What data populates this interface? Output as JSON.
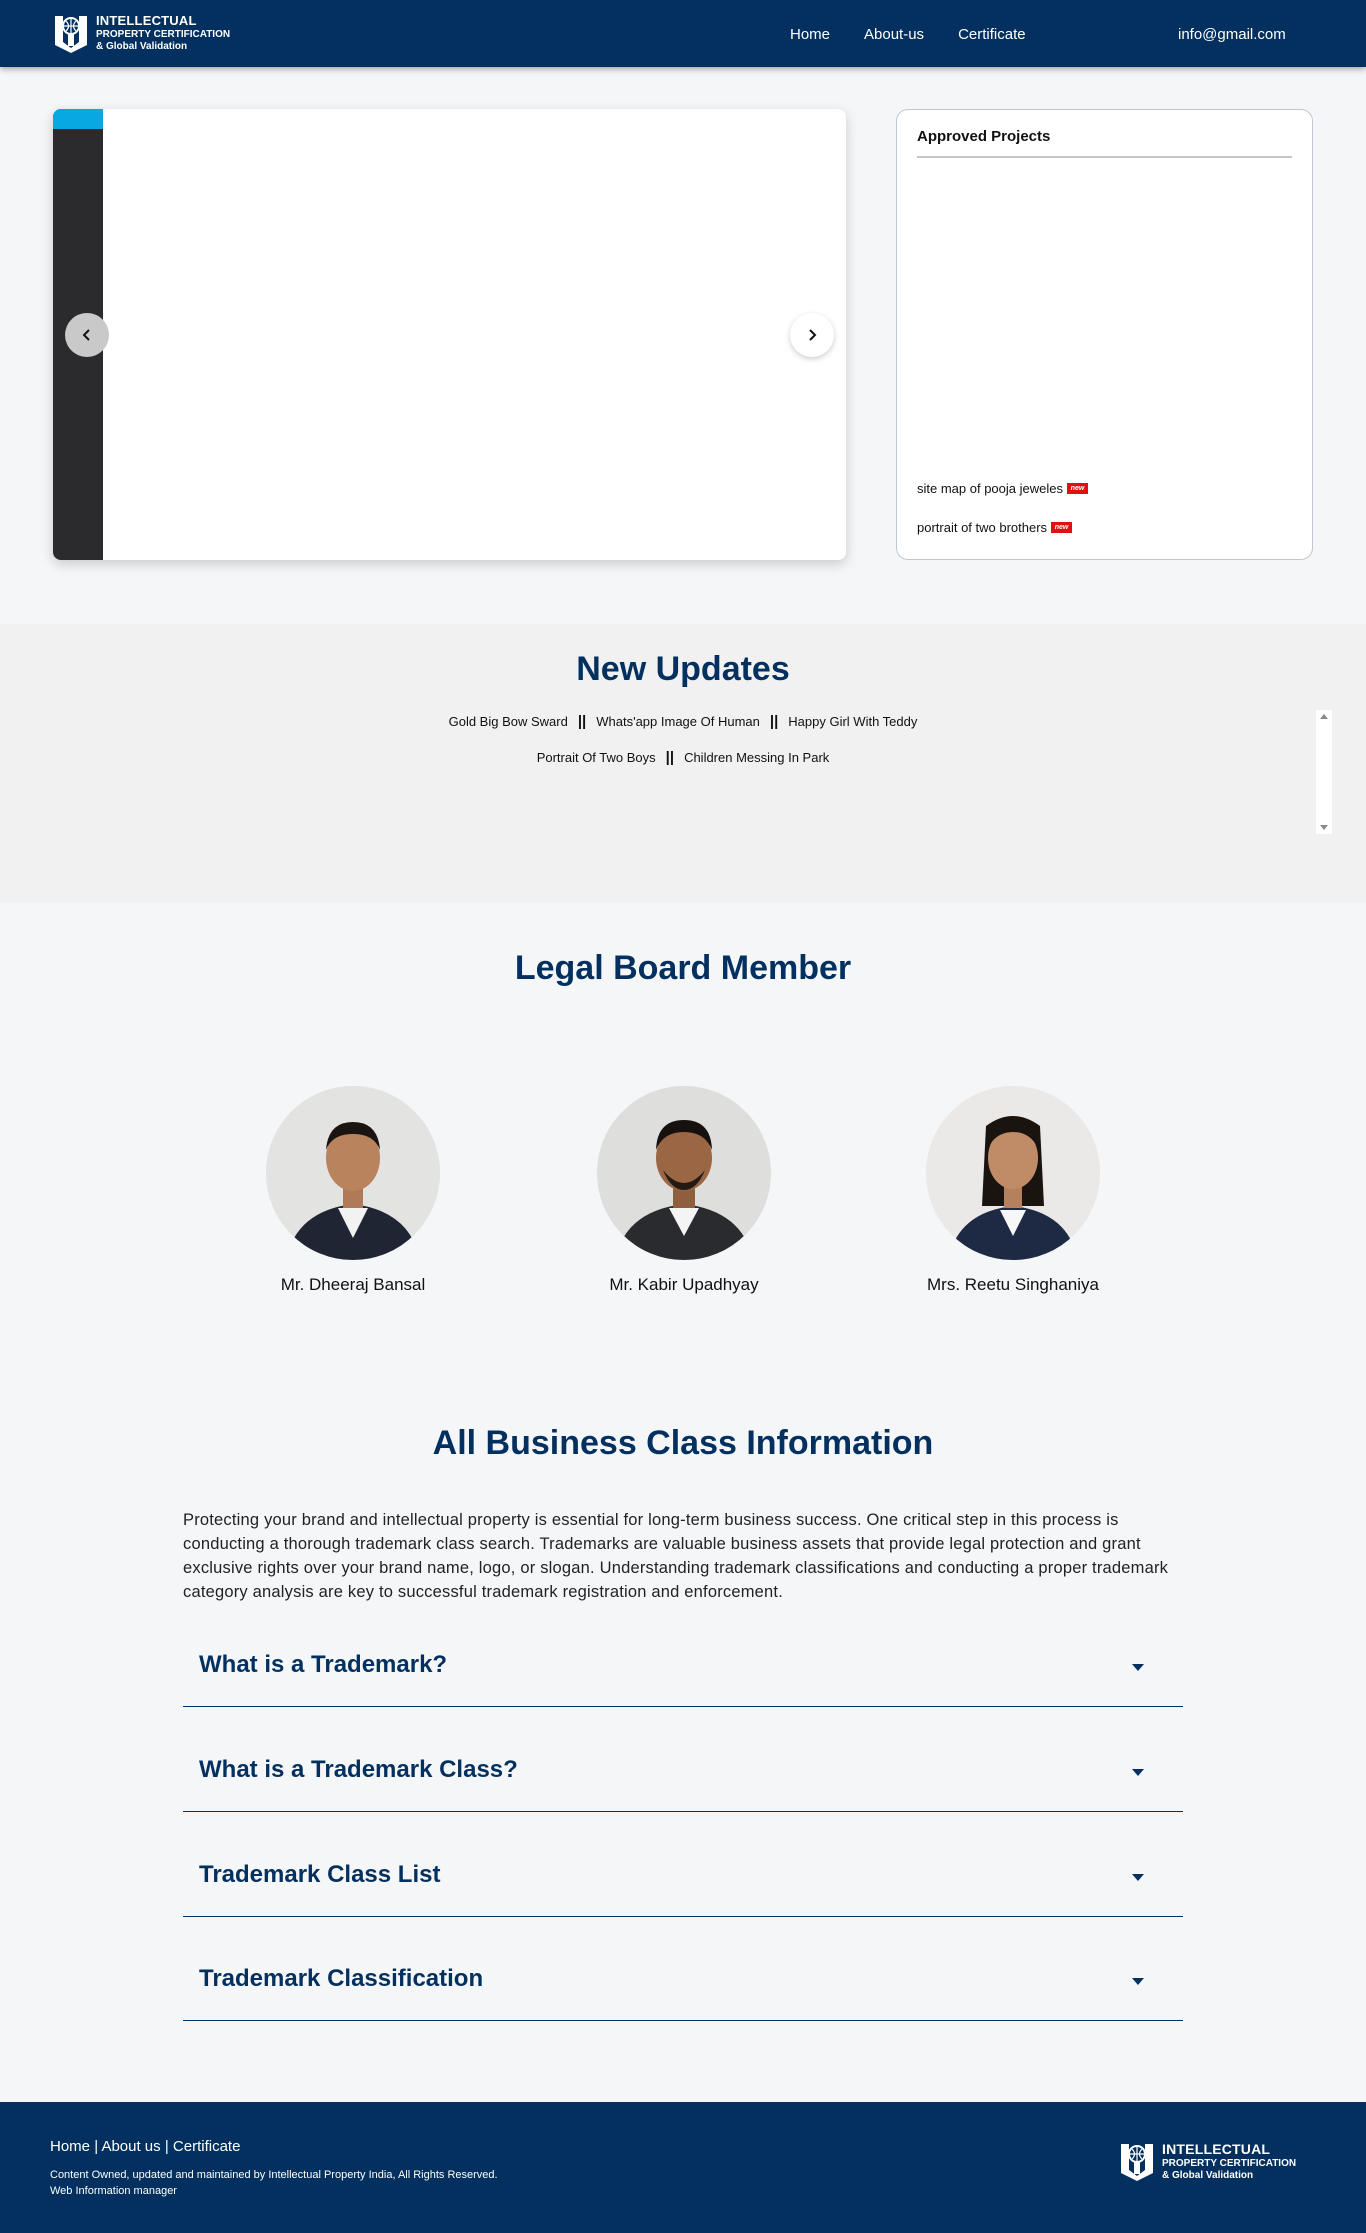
{
  "header": {
    "logo": {
      "line1": "INTELLECTUAL",
      "line2": "PROPERTY CERTIFICATION",
      "line3": "& Global Validation"
    },
    "nav": [
      "Home",
      "About-us",
      "Certificate"
    ],
    "email": "info@gmail.com"
  },
  "slider": {
    "prev_icon": "chevron-left-icon",
    "next_icon": "chevron-right-icon"
  },
  "approved": {
    "title": "Approved Projects",
    "items": [
      {
        "label": "site map of pooja jeweles",
        "badge": "new"
      },
      {
        "label": "portrait of two brothers",
        "badge": "new"
      }
    ]
  },
  "updates": {
    "title": "New Updates",
    "row1": [
      "Gold Big Bow Sward",
      "Whats'app Image Of Human",
      "Happy Girl With Teddy"
    ],
    "row2": [
      "Portrait Of Two Boys",
      "Children Messing In Park"
    ],
    "separator": "||"
  },
  "board": {
    "title": "Legal Board Member",
    "members": [
      {
        "name": "Mr. Dheeraj Bansal"
      },
      {
        "name": "Mr. Kabir Upadhyay"
      },
      {
        "name": "Mrs. Reetu Singhaniya"
      }
    ]
  },
  "business": {
    "title": "All Business Class Information",
    "paragraph": "Protecting your brand and intellectual property is essential for long-term business success. One critical step in this process is conducting a thorough trademark class search. Trademarks are valuable business assets that provide legal protection and grant exclusive rights over your brand name, logo, or slogan. Understanding trademark classifications and conducting a proper trademark category analysis are key to successful trademark registration and enforcement.",
    "accordion": [
      "What is a Trademark?",
      "What is a Trademark Class?",
      "Trademark Class List",
      "Trademark Classification"
    ]
  },
  "footer": {
    "links": [
      "Home",
      "About us",
      "Certificate"
    ],
    "link_separator": "|",
    "copyright": "Content Owned, updated and maintained by Intellectual Property India, All Rights Reserved.",
    "manager": "Web Information manager"
  },
  "colors": {
    "brand": "#03305f",
    "accent": "#08a9e3",
    "badge": "#e01010"
  }
}
